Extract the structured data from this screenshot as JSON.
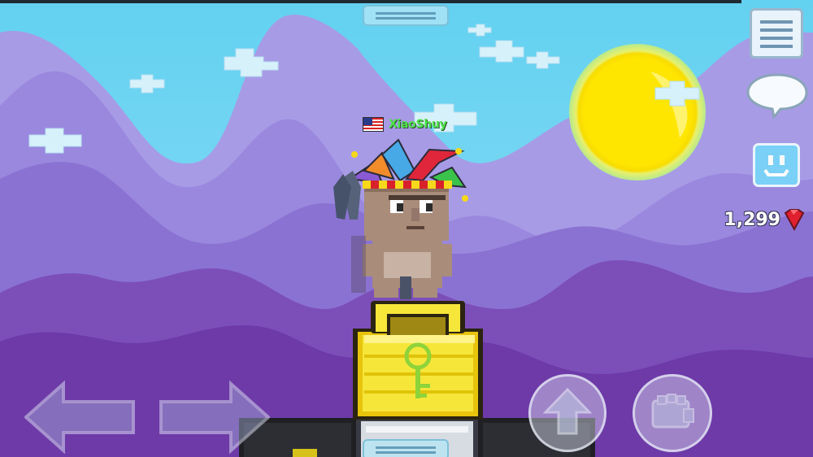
{
  "player": {
    "name": "XiaoShuy",
    "flag": "us-flag-icon"
  },
  "hud": {
    "gems": "1,299",
    "gem_icon": "red-gem-icon",
    "menu_icon": "menu-list-icon",
    "chat_icon": "chat-bubble-icon",
    "emote_icon": "smiley-face-icon"
  },
  "controls": {
    "left_icon": "left-arrow-icon",
    "right_icon": "right-arrow-icon",
    "jump_icon": "up-arrow-icon",
    "punch_icon": "fist-icon"
  },
  "world": {
    "lock_item": "golden-world-lock",
    "sky_color": "#6fd6f2",
    "sun_color": "#ffe000"
  }
}
